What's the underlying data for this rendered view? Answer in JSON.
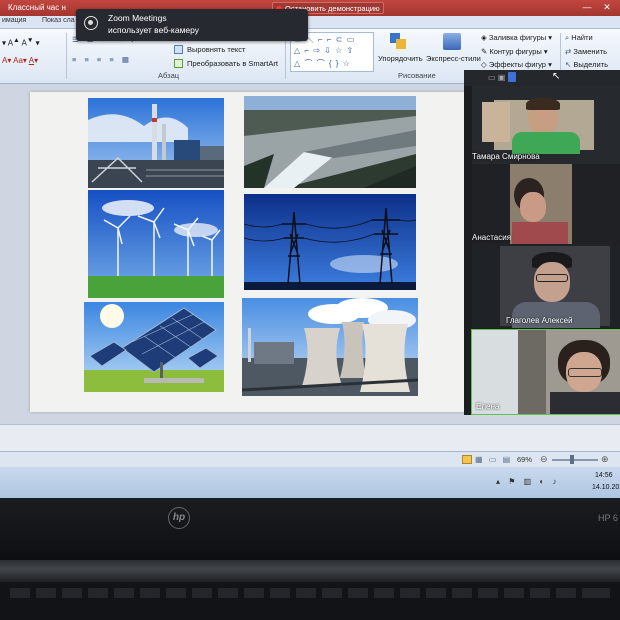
{
  "window": {
    "title": "Классный час н",
    "stop_share": "Остановить демонстрацию",
    "minimize": "—",
    "close": "✕"
  },
  "ribbon": {
    "tabs": [
      "имация",
      "Показ сла"
    ],
    "paragraph": {
      "align_text": "Выровнять текст",
      "smartart": "Преобразовать в SmartArt",
      "label": "Абзац"
    },
    "drawing": {
      "arrange": "Упорядочить",
      "quick_styles": "Экспресс-стили",
      "shape_fill": "Заливка фигуры",
      "shape_outline": "Контур фигуры",
      "shape_effects": "Эффекты фигур",
      "label": "Рисование"
    },
    "editing": {
      "find": "Найти",
      "replace": "Заменить",
      "select": "Выделить"
    }
  },
  "zoom_notification": {
    "title": "Zoom Meetings",
    "message": "использует веб-камеру"
  },
  "participants": [
    {
      "name": "Тамара Смирнова"
    },
    {
      "name": "Анастасия"
    },
    {
      "name": "Глаголев Алексей"
    },
    {
      "name": "Елена"
    }
  ],
  "slide": {
    "photos": [
      "thermal-power-plant",
      "hydro-dam",
      "wind-turbines",
      "power-lines",
      "solar-panels",
      "cooling-towers"
    ]
  },
  "status": {
    "zoom": "69%"
  },
  "clock": {
    "time": "14:56",
    "date": "14.10.20"
  },
  "laptop": {
    "logo": "hp",
    "model": "HP 6"
  },
  "colors": {
    "titlebar": "#b23c36",
    "ribbon": "#dce6f4",
    "zoom_panel": "#1b1d21",
    "accent": "#4a7fd4"
  }
}
